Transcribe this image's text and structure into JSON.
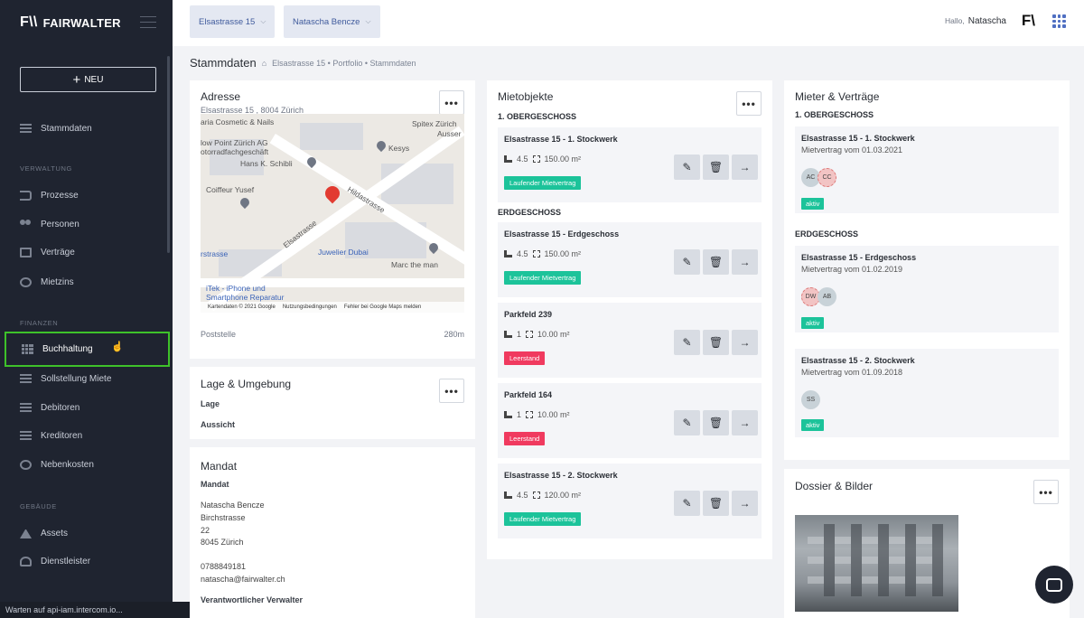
{
  "brand": {
    "name": "FAIRWALTER"
  },
  "sidebar": {
    "new_label": "NEU",
    "stammdaten": "Stammdaten",
    "sections": {
      "verwaltung": "VERWALTUNG",
      "finanzen": "FINANZEN",
      "gebaeude": "GEBÄUDE"
    },
    "verwaltung": [
      "Prozesse",
      "Personen",
      "Verträge",
      "Mietzins"
    ],
    "finanzen": [
      "Buchhaltung",
      "Sollstellung Miete",
      "Debitoren",
      "Kreditoren",
      "Nebenkosten"
    ],
    "gebaeude": [
      "Assets",
      "Dienstleister"
    ]
  },
  "status_text": "Warten auf api-iam.intercom.io...",
  "topbar": {
    "property": "Elsastrasse 15",
    "owner": "Natascha Bencze",
    "greeting": "Hallo,",
    "user": "Natascha"
  },
  "breadcrumb": {
    "title": "Stammdaten",
    "path": "Elsastrasse 15 • Portfolio • Stammdaten"
  },
  "address": {
    "title": "Adresse",
    "line": "Elsastrasse 15 , 8004 Zürich",
    "poststelle": "Poststelle",
    "distance": "280m",
    "map": {
      "labels": [
        "aria Cosmetic & Nails",
        "Spitex Zürich",
        "Ausser",
        "low Point Zürich AG",
        "otorradfachgeschäft",
        "Hans K. Schibli",
        "Kesys",
        "Coiffeur Yusef",
        "Hildastrasse",
        "Elsastrasse",
        "Juwelier Dubai",
        "Marc the man",
        "rstrasse",
        "iTek - iPhone und",
        "Smartphone Reparatur"
      ],
      "footer": [
        "Kartendaten © 2021 Google",
        "Nutzungsbedingungen",
        "Fehler bei Google Maps melden"
      ]
    }
  },
  "lage": {
    "title": "Lage & Umgebung",
    "lage": "Lage",
    "aussicht": "Aussicht"
  },
  "mandat": {
    "title": "Mandat",
    "label": "Mandat",
    "name": "Natascha Bencze",
    "street": "Birchstrasse",
    "nr": "22",
    "city": "8045 Zürich",
    "phone": "0788849181",
    "email": "natascha@fairwalter.ch",
    "verwalter": "Verantwortlicher Verwalter"
  },
  "mietobjekte": {
    "title": "Mietobjekte",
    "floors": [
      "1. OBERGESCHOSS",
      "ERDGESCHOSS"
    ],
    "units": [
      {
        "name": "Elsastrasse 15 - 1. Stockwerk",
        "rooms": "4.5",
        "area": "150.00 m²",
        "status": "Laufender Mietvertrag"
      },
      {
        "name": "Elsastrasse 15 - Erdgeschoss",
        "rooms": "4.5",
        "area": "150.00 m²",
        "status": "Laufender Mietvertrag"
      },
      {
        "name": "Parkfeld 239",
        "rooms": "1",
        "area": "10.00 m²",
        "status": "Leerstand"
      },
      {
        "name": "Parkfeld 164",
        "rooms": "1",
        "area": "10.00 m²",
        "status": "Leerstand"
      },
      {
        "name": "Elsastrasse 15 - 2. Stockwerk",
        "rooms": "4.5",
        "area": "120.00 m²",
        "status": "Laufender Mietvertrag"
      }
    ]
  },
  "mieter": {
    "title": "Mieter & Verträge",
    "floors": [
      "1. OBERGESCHOSS",
      "ERDGESCHOSS"
    ],
    "contracts": [
      {
        "name": "Elsastrasse 15 - 1. Stockwerk",
        "date": "Mietvertrag vom 01.03.2021",
        "avatars": [
          "AC",
          "CC"
        ],
        "status": "aktiv"
      },
      {
        "name": "Elsastrasse 15 - Erdgeschoss",
        "date": "Mietvertrag vom 01.02.2019",
        "avatars": [
          "DW",
          "AB"
        ],
        "status": "aktiv"
      },
      {
        "name": "Elsastrasse 15 - 2. Stockwerk",
        "date": "Mietvertrag vom 01.09.2018",
        "avatars": [
          "SS"
        ],
        "status": "aktiv"
      }
    ]
  },
  "dossier": {
    "title": "Dossier & Bilder"
  },
  "more_label": "•••",
  "colors": {
    "sidebar": "#1f2430",
    "accent": "#4f6fc2",
    "green": "#1cc39a",
    "red": "#f03a5f",
    "highlight": "#3ec22a"
  }
}
